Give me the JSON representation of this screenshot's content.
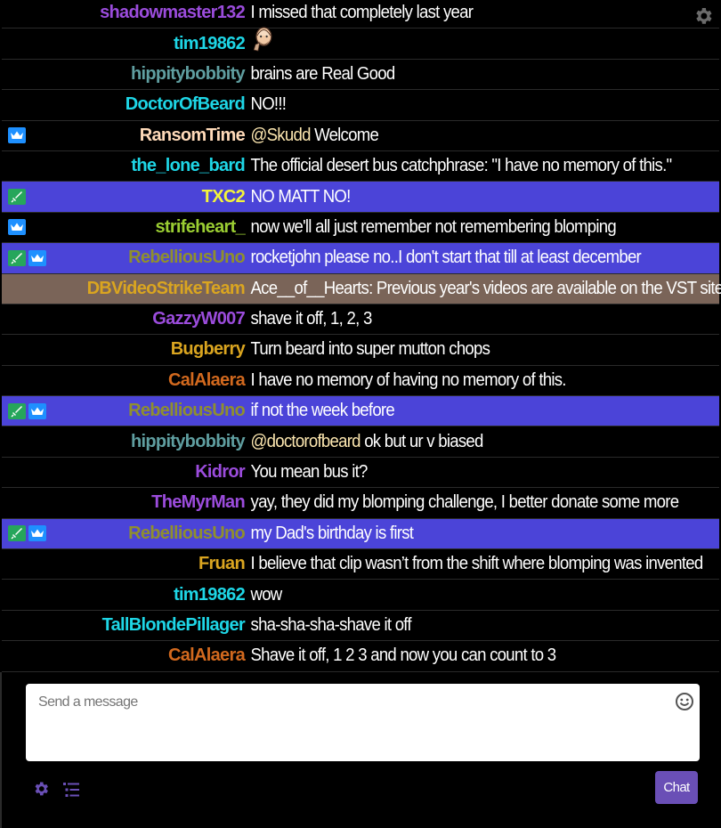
{
  "messages": [
    {
      "user": "shadowmaster132",
      "color": "#9b4cdc",
      "text": "I missed that completely last year",
      "bg": "",
      "badges": []
    },
    {
      "user": "tim19862",
      "color": "#1ed6e6",
      "text": "",
      "bg": "",
      "badges": [],
      "emote": "bald-face-emote"
    },
    {
      "user": "hippitybobbity",
      "color": "#5f9ea0",
      "text": "brains are Real Good",
      "bg": "",
      "badges": []
    },
    {
      "user": "DoctorOfBeard",
      "color": "#1ed6e6",
      "text": "NO!!!",
      "bg": "",
      "badges": []
    },
    {
      "user": "RansomTime",
      "color": "#ffdab9",
      "mention": "@Skudd",
      "text": " Welcome",
      "bg": "",
      "badges": [
        "crown"
      ]
    },
    {
      "user": "the_lone_bard",
      "color": "#1ed6e6",
      "text": "The official desert bus catchphrase: \"I have no memory of this.\"",
      "bg": "",
      "badges": []
    },
    {
      "user": "TXC2",
      "color": "#f4f43a",
      "text": "NO MATT NO!",
      "bg": "highlight",
      "badges": [
        "sword"
      ]
    },
    {
      "user": "strifeheart_",
      "color": "#9acd32",
      "text": "now we'll all just remember not remembering blomping",
      "bg": "",
      "badges": [
        "crown"
      ]
    },
    {
      "user": "RebelliousUno",
      "color": "#8f8f2e",
      "text": "rocketjohn please no..I don't start that till at least december",
      "bg": "highlight",
      "badges": [
        "sword",
        "crown"
      ]
    },
    {
      "user": "DBVideoStrikeTeam",
      "color": "#daa520",
      "text": "Ace__of__Hearts: Previous year's videos are available on the VST site",
      "bg": "brown",
      "badges": []
    },
    {
      "user": "GazzyW007",
      "color": "#9b4cdc",
      "text": "shave it off, 1, 2, 3",
      "bg": "",
      "badges": []
    },
    {
      "user": "Bugberry",
      "color": "#daa520",
      "text": "Turn beard into super mutton chops",
      "bg": "",
      "badges": []
    },
    {
      "user": "CalAlaera",
      "color": "#d2691e",
      "text": "I have no memory of having no memory of this.",
      "bg": "",
      "badges": []
    },
    {
      "user": "RebelliousUno",
      "color": "#8f8f2e",
      "text": "if not the week before",
      "bg": "highlight",
      "badges": [
        "sword",
        "crown"
      ]
    },
    {
      "user": "hippitybobbity",
      "color": "#5f9ea0",
      "mention": "@doctorofbeard",
      "text": " ok but ur v biased",
      "bg": "",
      "badges": []
    },
    {
      "user": "Kidror",
      "color": "#9b4cdc",
      "text": "You mean bus it?",
      "bg": "",
      "badges": []
    },
    {
      "user": "TheMyrMan",
      "color": "#9b4cdc",
      "text": "yay, they did my blomping challenge, I better donate some more",
      "bg": "",
      "badges": []
    },
    {
      "user": "RebelliousUno",
      "color": "#8f8f2e",
      "text": "my Dad's birthday is first",
      "bg": "highlight",
      "badges": [
        "sword",
        "crown"
      ]
    },
    {
      "user": "Fruan",
      "color": "#daa520",
      "text": "I believe that clip wasn’t from the shift where blomping was invented",
      "bg": "",
      "badges": []
    },
    {
      "user": "tim19862",
      "color": "#1ed6e6",
      "text": "wow",
      "bg": "",
      "badges": []
    },
    {
      "user": "TallBlondePillager",
      "color": "#1ed6e6",
      "text": "sha-sha-sha-shave it off",
      "bg": "",
      "badges": []
    },
    {
      "user": "CalAlaera",
      "color": "#d2691e",
      "text": "Shave it off, 1 2 3 and now you can count to 3",
      "bg": "",
      "badges": []
    }
  ],
  "composer": {
    "placeholder": "Send a message",
    "chat_label": "Chat"
  },
  "colors": {
    "highlight": "#4b44d8",
    "brown": "#7a6458",
    "chat_button": "#6a4fb6",
    "icon": "#6a4fb6"
  }
}
